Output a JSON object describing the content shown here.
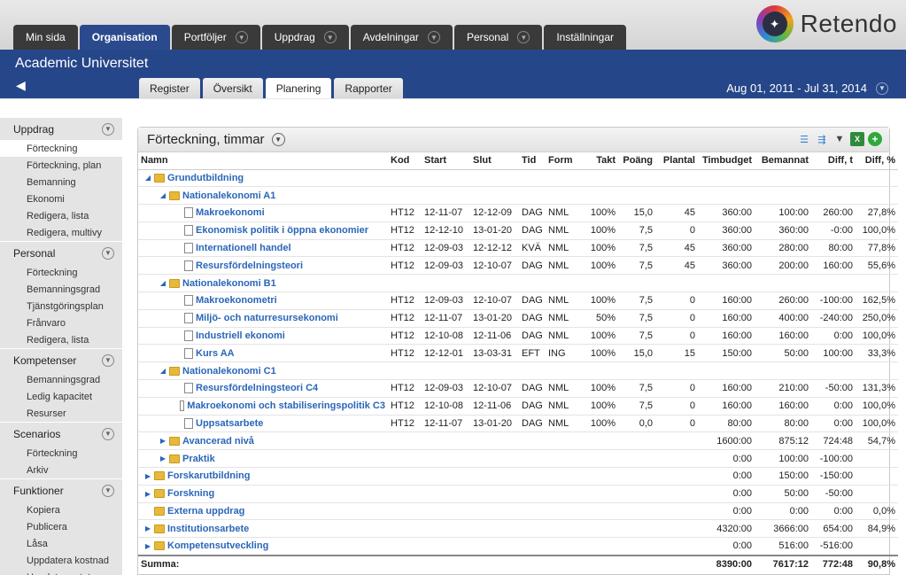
{
  "topnav": {
    "tabs": [
      {
        "label": "Min sida",
        "dropdown": false,
        "active": false
      },
      {
        "label": "Organisation",
        "dropdown": false,
        "active": true
      },
      {
        "label": "Portföljer",
        "dropdown": true,
        "active": false
      },
      {
        "label": "Uppdrag",
        "dropdown": true,
        "active": false
      },
      {
        "label": "Avdelningar",
        "dropdown": true,
        "active": false
      },
      {
        "label": "Personal",
        "dropdown": true,
        "active": false
      },
      {
        "label": "Inställningar",
        "dropdown": false,
        "active": false
      }
    ],
    "logo_text": "Retendo"
  },
  "header": {
    "org_title": "Academic Universitet",
    "subtabs": [
      {
        "label": "Register",
        "active": false
      },
      {
        "label": "Översikt",
        "active": false
      },
      {
        "label": "Planering",
        "active": true
      },
      {
        "label": "Rapporter",
        "active": false
      }
    ],
    "date_range": "Aug 01, 2011 - Jul 31, 2014"
  },
  "sidebar": [
    {
      "title": "Uppdrag",
      "items": [
        "Förteckning",
        "Förteckning, plan",
        "Bemanning",
        "Ekonomi",
        "Redigera, lista",
        "Redigera, multivy"
      ],
      "active": 0
    },
    {
      "title": "Personal",
      "items": [
        "Förteckning",
        "Bemanningsgrad",
        "Tjänstgöringsplan",
        "Frånvaro",
        "Redigera, lista"
      ],
      "active": -1
    },
    {
      "title": "Kompetenser",
      "items": [
        "Bemanningsgrad",
        "Ledig kapacitet",
        "Resurser"
      ],
      "active": -1
    },
    {
      "title": "Scenarios",
      "items": [
        "Förteckning",
        "Arkiv"
      ],
      "active": -1
    },
    {
      "title": "Funktioner",
      "items": [
        "Kopiera",
        "Publicera",
        "Låsa",
        "Uppdatera kostnad",
        "Uppdatera status"
      ],
      "active": -1
    }
  ],
  "panel": {
    "title": "Förteckning, timmar",
    "columns": [
      "Namn",
      "Kod",
      "Start",
      "Slut",
      "Tid",
      "Form",
      "Takt",
      "Poäng",
      "Plantal",
      "Timbudget",
      "Bemannat",
      "Diff, t",
      "Diff, %"
    ],
    "rows": [
      {
        "level": 0,
        "type": "folder",
        "toggle": "open",
        "cells": [
          "Grundutbildning",
          "",
          "",
          "",
          "",
          "",
          "",
          "",
          "",
          "",
          "",
          "",
          ""
        ]
      },
      {
        "level": 1,
        "type": "folder",
        "toggle": "open",
        "cells": [
          "Nationalekonomi A1",
          "",
          "",
          "",
          "",
          "",
          "",
          "",
          "",
          "",
          "",
          "",
          ""
        ]
      },
      {
        "level": 2,
        "type": "doc",
        "toggle": "",
        "cells": [
          "Makroekonomi",
          "HT12",
          "12-11-07",
          "12-12-09",
          "DAG",
          "NML",
          "100%",
          "15,0",
          "45",
          "360:00",
          "100:00",
          "260:00",
          "27,8%"
        ]
      },
      {
        "level": 2,
        "type": "doc",
        "toggle": "",
        "cells": [
          "Ekonomisk politik i öppna ekonomier",
          "HT12",
          "12-12-10",
          "13-01-20",
          "DAG",
          "NML",
          "100%",
          "7,5",
          "0",
          "360:00",
          "360:00",
          "-0:00",
          "100,0%"
        ]
      },
      {
        "level": 2,
        "type": "doc",
        "toggle": "",
        "cells": [
          "Internationell handel",
          "HT12",
          "12-09-03",
          "12-12-12",
          "KVÄ",
          "NML",
          "100%",
          "7,5",
          "45",
          "360:00",
          "280:00",
          "80:00",
          "77,8%"
        ]
      },
      {
        "level": 2,
        "type": "doc",
        "toggle": "",
        "cells": [
          "Resursfördelningsteori",
          "HT12",
          "12-09-03",
          "12-10-07",
          "DAG",
          "NML",
          "100%",
          "7,5",
          "45",
          "360:00",
          "200:00",
          "160:00",
          "55,6%"
        ]
      },
      {
        "level": 1,
        "type": "folder",
        "toggle": "open",
        "cells": [
          "Nationalekonomi B1",
          "",
          "",
          "",
          "",
          "",
          "",
          "",
          "",
          "",
          "",
          "",
          ""
        ]
      },
      {
        "level": 2,
        "type": "doc",
        "toggle": "",
        "cells": [
          "Makroekonometri",
          "HT12",
          "12-09-03",
          "12-10-07",
          "DAG",
          "NML",
          "100%",
          "7,5",
          "0",
          "160:00",
          "260:00",
          "-100:00",
          "162,5%"
        ]
      },
      {
        "level": 2,
        "type": "doc",
        "toggle": "",
        "cells": [
          "Miljö- och naturresursekonomi",
          "HT12",
          "12-11-07",
          "13-01-20",
          "DAG",
          "NML",
          "50%",
          "7,5",
          "0",
          "160:00",
          "400:00",
          "-240:00",
          "250,0%"
        ]
      },
      {
        "level": 2,
        "type": "doc",
        "toggle": "",
        "cells": [
          "Industriell ekonomi",
          "HT12",
          "12-10-08",
          "12-11-06",
          "DAG",
          "NML",
          "100%",
          "7,5",
          "0",
          "160:00",
          "160:00",
          "0:00",
          "100,0%"
        ]
      },
      {
        "level": 2,
        "type": "doc",
        "toggle": "",
        "cells": [
          "Kurs AA",
          "HT12",
          "12-12-01",
          "13-03-31",
          "EFT",
          "ING",
          "100%",
          "15,0",
          "15",
          "150:00",
          "50:00",
          "100:00",
          "33,3%"
        ]
      },
      {
        "level": 1,
        "type": "folder",
        "toggle": "open",
        "cells": [
          "Nationalekonomi C1",
          "",
          "",
          "",
          "",
          "",
          "",
          "",
          "",
          "",
          "",
          "",
          ""
        ]
      },
      {
        "level": 2,
        "type": "doc",
        "toggle": "",
        "cells": [
          "Resursfördelningsteori C4",
          "HT12",
          "12-09-03",
          "12-10-07",
          "DAG",
          "NML",
          "100%",
          "7,5",
          "0",
          "160:00",
          "210:00",
          "-50:00",
          "131,3%"
        ]
      },
      {
        "level": 2,
        "type": "doc",
        "toggle": "",
        "cells": [
          "Makroekonomi och stabiliseringspolitik C3",
          "HT12",
          "12-10-08",
          "12-11-06",
          "DAG",
          "NML",
          "100%",
          "7,5",
          "0",
          "160:00",
          "160:00",
          "0:00",
          "100,0%"
        ]
      },
      {
        "level": 2,
        "type": "doc",
        "toggle": "",
        "cells": [
          "Uppsatsarbete",
          "HT12",
          "12-11-07",
          "13-01-20",
          "DAG",
          "NML",
          "100%",
          "0,0",
          "0",
          "80:00",
          "80:00",
          "0:00",
          "100,0%"
        ]
      },
      {
        "level": 1,
        "type": "folder",
        "toggle": "closed",
        "cells": [
          "Avancerad nivå",
          "",
          "",
          "",
          "",
          "",
          "",
          "",
          "",
          "1600:00",
          "875:12",
          "724:48",
          "54,7%"
        ]
      },
      {
        "level": 1,
        "type": "folder",
        "toggle": "closed",
        "cells": [
          "Praktik",
          "",
          "",
          "",
          "",
          "",
          "",
          "",
          "",
          "0:00",
          "100:00",
          "-100:00",
          ""
        ]
      },
      {
        "level": 0,
        "type": "folder",
        "toggle": "closed",
        "cells": [
          "Forskarutbildning",
          "",
          "",
          "",
          "",
          "",
          "",
          "",
          "",
          "0:00",
          "150:00",
          "-150:00",
          ""
        ]
      },
      {
        "level": 0,
        "type": "folder",
        "toggle": "closed",
        "cells": [
          "Forskning",
          "",
          "",
          "",
          "",
          "",
          "",
          "",
          "",
          "0:00",
          "50:00",
          "-50:00",
          ""
        ]
      },
      {
        "level": 0,
        "type": "folder",
        "toggle": "",
        "cells": [
          "Externa uppdrag",
          "",
          "",
          "",
          "",
          "",
          "",
          "",
          "",
          "0:00",
          "0:00",
          "0:00",
          "0,0%"
        ]
      },
      {
        "level": 0,
        "type": "folder",
        "toggle": "closed",
        "cells": [
          "Institutionsarbete",
          "",
          "",
          "",
          "",
          "",
          "",
          "",
          "",
          "4320:00",
          "3666:00",
          "654:00",
          "84,9%"
        ]
      },
      {
        "level": 0,
        "type": "folder",
        "toggle": "closed",
        "cells": [
          "Kompetensutveckling",
          "",
          "",
          "",
          "",
          "",
          "",
          "",
          "",
          "0:00",
          "516:00",
          "-516:00",
          ""
        ]
      }
    ],
    "summary": [
      "Summa:",
      "",
      "",
      "",
      "",
      "",
      "",
      "",
      "",
      "8390:00",
      "7617:12",
      "772:48",
      "90,8%"
    ]
  }
}
